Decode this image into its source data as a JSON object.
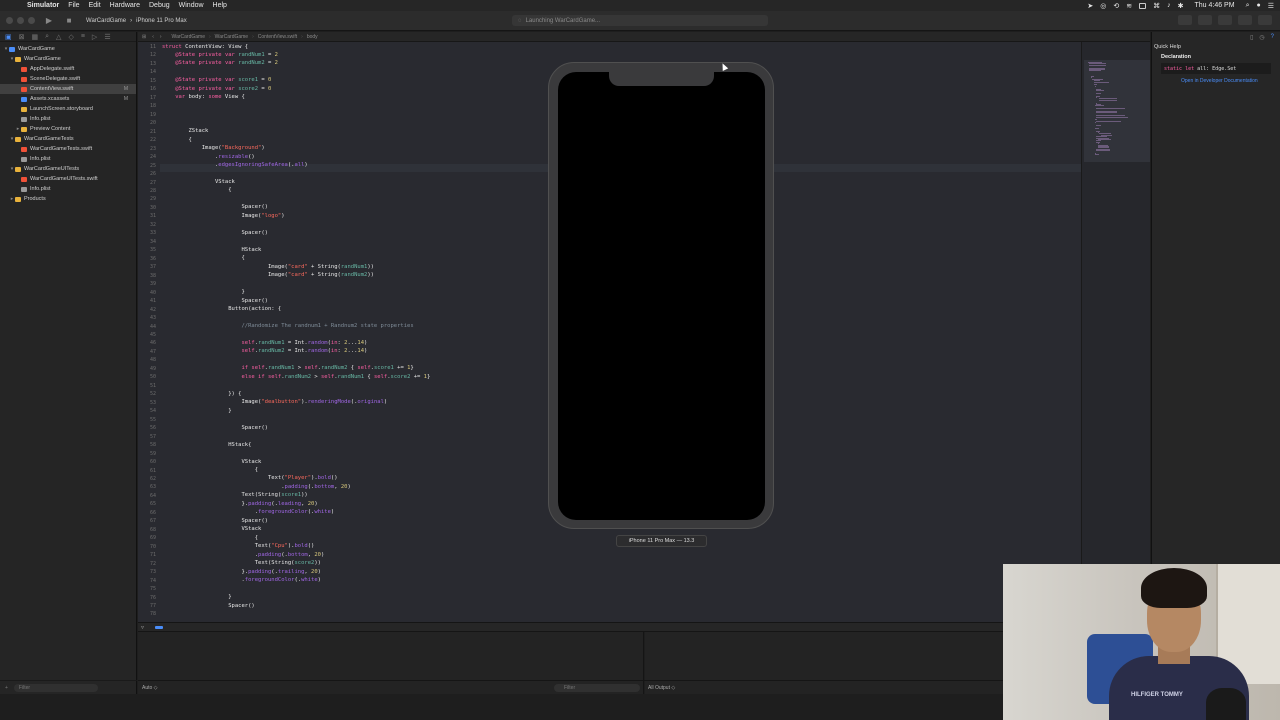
{
  "menubar": {
    "app": "Simulator",
    "items": [
      "File",
      "Edit",
      "Hardware",
      "Debug",
      "Window",
      "Help"
    ],
    "clock": "Thu 4:46 PM"
  },
  "toolbar": {
    "scheme": "WarCardGame",
    "device": "iPhone 11 Pro Max",
    "activity": "Launching WarCardGame..."
  },
  "navigator": {
    "items": [
      {
        "label": "WarCardGame",
        "depth": 0,
        "type": "project"
      },
      {
        "label": "WarCardGame",
        "depth": 1,
        "type": "folder"
      },
      {
        "label": "AppDelegate.swift",
        "depth": 2,
        "type": "swift"
      },
      {
        "label": "SceneDelegate.swift",
        "depth": 2,
        "type": "swift"
      },
      {
        "label": "ContentView.swift",
        "depth": 2,
        "type": "swift",
        "selected": true,
        "badge": "M"
      },
      {
        "label": "Assets.xcassets",
        "depth": 2,
        "type": "assets",
        "badge": "M"
      },
      {
        "label": "LaunchScreen.storyboard",
        "depth": 2,
        "type": "storyboard"
      },
      {
        "label": "Info.plist",
        "depth": 2,
        "type": "plist"
      },
      {
        "label": "Preview Content",
        "depth": 2,
        "type": "folder"
      },
      {
        "label": "WarCardGameTests",
        "depth": 1,
        "type": "folder"
      },
      {
        "label": "WarCardGameTests.swift",
        "depth": 2,
        "type": "swift"
      },
      {
        "label": "Info.plist",
        "depth": 2,
        "type": "plist"
      },
      {
        "label": "WarCardGameUITests",
        "depth": 1,
        "type": "folder"
      },
      {
        "label": "WarCardGameUITests.swift",
        "depth": 2,
        "type": "swift"
      },
      {
        "label": "Info.plist",
        "depth": 2,
        "type": "plist"
      },
      {
        "label": "Products",
        "depth": 1,
        "type": "folder"
      }
    ],
    "filter_placeholder": "Filter"
  },
  "jumpbar": {
    "crumbs": [
      "WarCardGame",
      "WarCardGame",
      "ContentView.swift",
      "body"
    ]
  },
  "editor": {
    "lines": [
      {
        "n": "11",
        "text": "struct ContentView: View {"
      },
      {
        "n": "12",
        "text": "    @State private var randNum1 = 2"
      },
      {
        "n": "13",
        "text": "    @State private var randNum2 = 2"
      },
      {
        "n": "14",
        "text": ""
      },
      {
        "n": "15",
        "text": "    @State private var score1 = 0"
      },
      {
        "n": "16",
        "text": "    @State private var score2 = 0"
      },
      {
        "n": "17",
        "text": "    var body: some View {"
      },
      {
        "n": "18",
        "text": ""
      },
      {
        "n": "19",
        "text": ""
      },
      {
        "n": "20",
        "text": ""
      },
      {
        "n": "21",
        "text": "        ZStack"
      },
      {
        "n": "22",
        "text": "        {"
      },
      {
        "n": "23",
        "text": "            Image(\"Background\")"
      },
      {
        "n": "24",
        "text": "                .resizable()"
      },
      {
        "n": "25",
        "text": "                .edgesIgnoringSafeArea(.all)"
      },
      {
        "n": "26",
        "text": ""
      },
      {
        "n": "27",
        "text": "                VStack"
      },
      {
        "n": "28",
        "text": "                    {"
      },
      {
        "n": "29",
        "text": ""
      },
      {
        "n": "30",
        "text": "                        Spacer()"
      },
      {
        "n": "31",
        "text": "                        Image(\"logo\")"
      },
      {
        "n": "32",
        "text": ""
      },
      {
        "n": "33",
        "text": "                        Spacer()"
      },
      {
        "n": "34",
        "text": ""
      },
      {
        "n": "35",
        "text": "                        HStack"
      },
      {
        "n": "36",
        "text": "                        {"
      },
      {
        "n": "37",
        "text": "                                Image(\"card\" + String(randNum1))"
      },
      {
        "n": "38",
        "text": "                                Image(\"card\" + String(randNum2))"
      },
      {
        "n": "39",
        "text": ""
      },
      {
        "n": "40",
        "text": "                        }"
      },
      {
        "n": "41",
        "text": "                        Spacer()"
      },
      {
        "n": "42",
        "text": "                    Button(action: {"
      },
      {
        "n": "43",
        "text": ""
      },
      {
        "n": "44",
        "text": "                        //Randomize The randnum1 + Randnum2 state properties"
      },
      {
        "n": "45",
        "text": ""
      },
      {
        "n": "46",
        "text": "                        self.randNum1 = Int.random(in: 2...14)"
      },
      {
        "n": "47",
        "text": "                        self.randNum2 = Int.random(in: 2...14)"
      },
      {
        "n": "48",
        "text": ""
      },
      {
        "n": "49",
        "text": "                        if self.randNum1 > self.randNum2 { self.score1 += 1}"
      },
      {
        "n": "50",
        "text": "                        else if self.randNum2 > self.randNum1 { self.score2 += 1}"
      },
      {
        "n": "51",
        "text": ""
      },
      {
        "n": "52",
        "text": "                    }) {"
      },
      {
        "n": "53",
        "text": "                        Image(\"dealbutton\").renderingMode(.original)"
      },
      {
        "n": "54",
        "text": "                    }"
      },
      {
        "n": "55",
        "text": ""
      },
      {
        "n": "56",
        "text": "                        Spacer()"
      },
      {
        "n": "57",
        "text": ""
      },
      {
        "n": "58",
        "text": "                    HStack{"
      },
      {
        "n": "59",
        "text": ""
      },
      {
        "n": "60",
        "text": "                        VStack"
      },
      {
        "n": "61",
        "text": "                            {"
      },
      {
        "n": "62",
        "text": "                                Text(\"Player\").bold()"
      },
      {
        "n": "63",
        "text": "                                    .padding(.bottom, 20)"
      },
      {
        "n": "64",
        "text": "                        Text(String(score1))"
      },
      {
        "n": "65",
        "text": "                        }.padding(.leading, 20)"
      },
      {
        "n": "66",
        "text": "                            .foregroundColor(.white)"
      },
      {
        "n": "67",
        "text": "                        Spacer()"
      },
      {
        "n": "68",
        "text": "                        VStack"
      },
      {
        "n": "69",
        "text": "                            {"
      },
      {
        "n": "70",
        "text": "                            Text(\"Cpu\").bold()"
      },
      {
        "n": "71",
        "text": "                            .padding(.bottom, 20)"
      },
      {
        "n": "72",
        "text": "                            Text(String(score2))"
      },
      {
        "n": "73",
        "text": "                        }.padding(.trailing, 20)"
      },
      {
        "n": "74",
        "text": "                        .foregroundColor(.white)"
      },
      {
        "n": "75",
        "text": ""
      },
      {
        "n": "76",
        "text": "                    }"
      },
      {
        "n": "77",
        "text": "                    Spacer()"
      },
      {
        "n": "78",
        "text": ""
      }
    ]
  },
  "debug": {
    "auto_label": "Auto ◇",
    "filter_placeholder": "Filter",
    "output_label": "All Output ◇"
  },
  "inspector": {
    "title": "Quick Help",
    "declaration_label": "Declaration",
    "signature": "static let all: Edge.Set",
    "doc_link": "Open in Developer Documentation"
  },
  "simulator": {
    "device_label": "iPhone 11 Pro Max — 13.3"
  },
  "webcam": {
    "shirt_text": "HILFIGER TOMMY"
  },
  "colors": {
    "keyword": "#fc5fa3",
    "string": "#fc6a5d",
    "number": "#d9c97c",
    "accent": "#4a8df8"
  }
}
